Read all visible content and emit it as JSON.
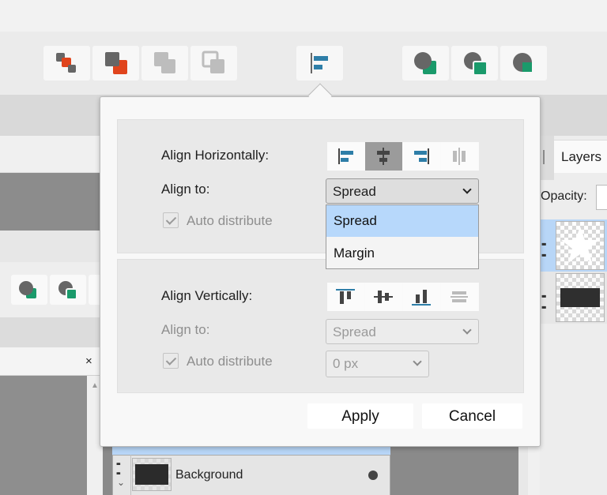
{
  "colors": {
    "accent_orange": "#e0441c",
    "accent_green": "#1a9a6b",
    "accent_blue": "#2e7ea8",
    "selection_blue": "#b7d8fb"
  },
  "toolbar": {
    "buttons": [
      {
        "name": "arrange-front-icon"
      },
      {
        "name": "arrange-forward-icon"
      },
      {
        "name": "arrange-backward-icon"
      },
      {
        "name": "arrange-back-icon"
      },
      {
        "name": "align-icon"
      },
      {
        "name": "boolean-add-icon"
      },
      {
        "name": "boolean-subtract-icon"
      },
      {
        "name": "boolean-intersect-icon"
      }
    ]
  },
  "layers_panel": {
    "tab_label": "Layers",
    "opacity_label": "Opacity:",
    "background_layer_label": "Background"
  },
  "dialog": {
    "horizontal": {
      "label": "Align Horizontally:",
      "align_to_label": "Align to:",
      "align_to_value": "Spread",
      "auto_distribute_label": "Auto distribute",
      "options": [
        "Spread",
        "Margin"
      ],
      "selected_option": "Spread"
    },
    "vertical": {
      "label": "Align Vertically:",
      "align_to_label": "Align to:",
      "align_to_value": "Spread",
      "auto_distribute_label": "Auto distribute",
      "spacing_value": "0 px"
    },
    "apply_label": "Apply",
    "cancel_label": "Cancel"
  }
}
